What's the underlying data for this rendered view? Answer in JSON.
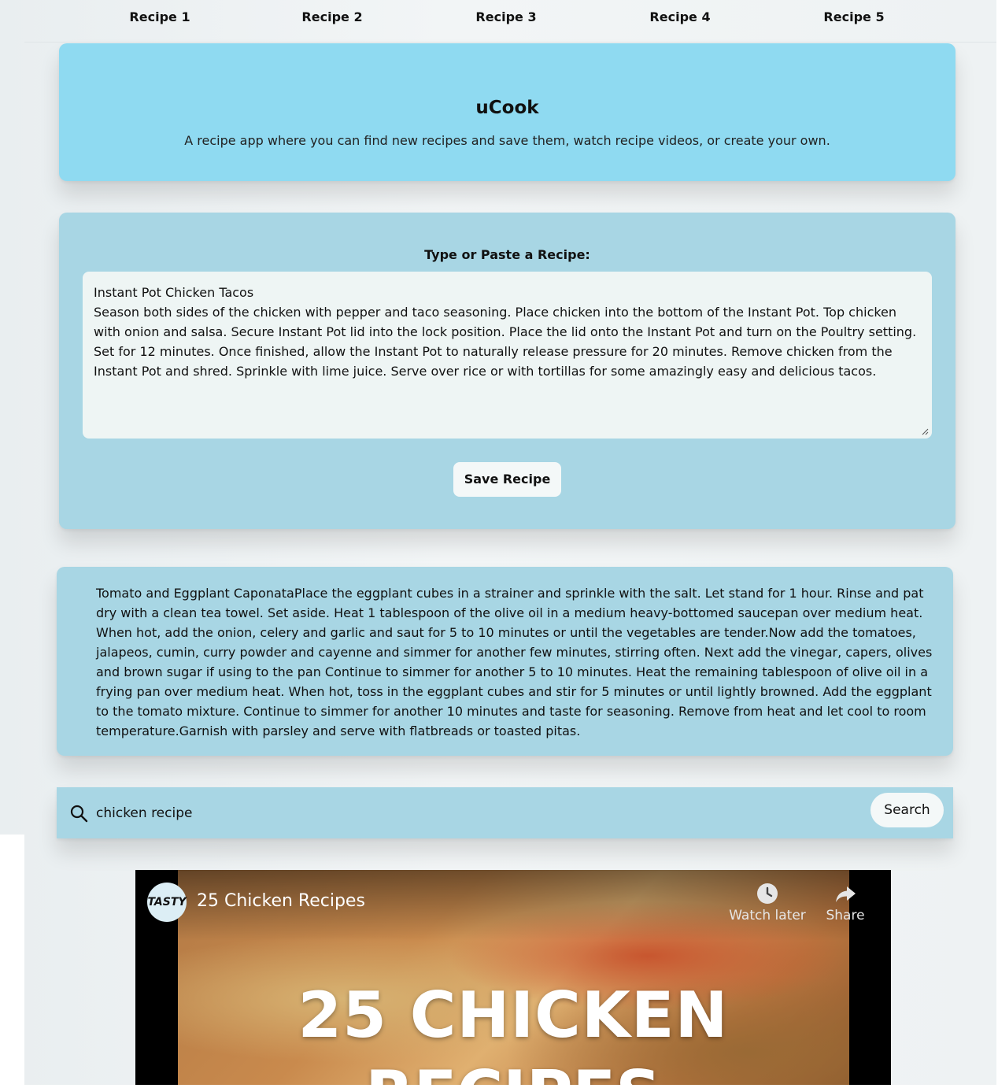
{
  "nav": {
    "items": [
      {
        "label": "Recipe 1"
      },
      {
        "label": "Recipe 2"
      },
      {
        "label": "Recipe 3"
      },
      {
        "label": "Recipe 4"
      },
      {
        "label": "Recipe 5"
      }
    ]
  },
  "hero": {
    "title": "uCook",
    "subtitle": "A recipe app where you can find new recipes and save them, watch recipe videos, or create your own."
  },
  "editor": {
    "label": "Type or Paste a Recipe:",
    "value": "Instant Pot Chicken Tacos\nSeason both sides of the chicken with pepper and taco seasoning. Place chicken into the bottom of the Instant Pot. Top chicken with onion and salsa. Secure Instant Pot lid into the lock position. Place the lid onto the Instant Pot and turn on the Poultry setting. Set for 12 minutes. Once finished, allow the Instant Pot to naturally release pressure for 20 minutes. Remove chicken from the Instant Pot and shred. Sprinkle with lime juice. Serve over rice or with tortillas for some amazingly easy and delicious tacos.",
    "save_label": "Save Recipe"
  },
  "saved_recipe": {
    "text": "Tomato and Eggplant CaponataPlace the eggplant cubes in a strainer and sprinkle with the salt. Let stand for 1 hour. Rinse and pat dry with a clean tea towel. Set aside. Heat 1 tablespoon of the olive oil in a medium heavy-bottomed saucepan over medium heat. When hot, add the onion, celery and garlic and saut for 5 to 10 minutes or until the vegetables are tender.Now add the tomatoes, jalapeos, cumin, curry powder and cayenne and simmer for another few minutes, stirring often. Next add the vinegar, capers, olives and brown sugar if using to the pan Continue to simmer for another 5 to 10 minutes. Heat the remaining tablespoon of olive oil in a frying pan over medium heat. When hot, toss in the eggplant cubes and stir for 5 minutes or until lightly browned. Add the eggplant to the tomato mixture. Continue to simmer for another 10 minutes and taste for seasoning. Remove from heat and let cool to room temperature.Garnish with parsley and serve with flatbreads or toasted pitas."
  },
  "search": {
    "value": "chicken recipe",
    "button_label": "Search",
    "icon": "search-icon"
  },
  "video": {
    "channel_logo": "TASTY",
    "title": "25 Chicken Recipes",
    "watch_later_label": "Watch later",
    "share_label": "Share",
    "overlay_line1": "25 CHICKEN",
    "overlay_line2": "RECIPES"
  },
  "colors": {
    "hero_bg": "#8fdaf1",
    "panel_bg": "#a8d6e4",
    "textarea_bg": "#eef5f4",
    "button_bg": "#f4f8f8"
  }
}
